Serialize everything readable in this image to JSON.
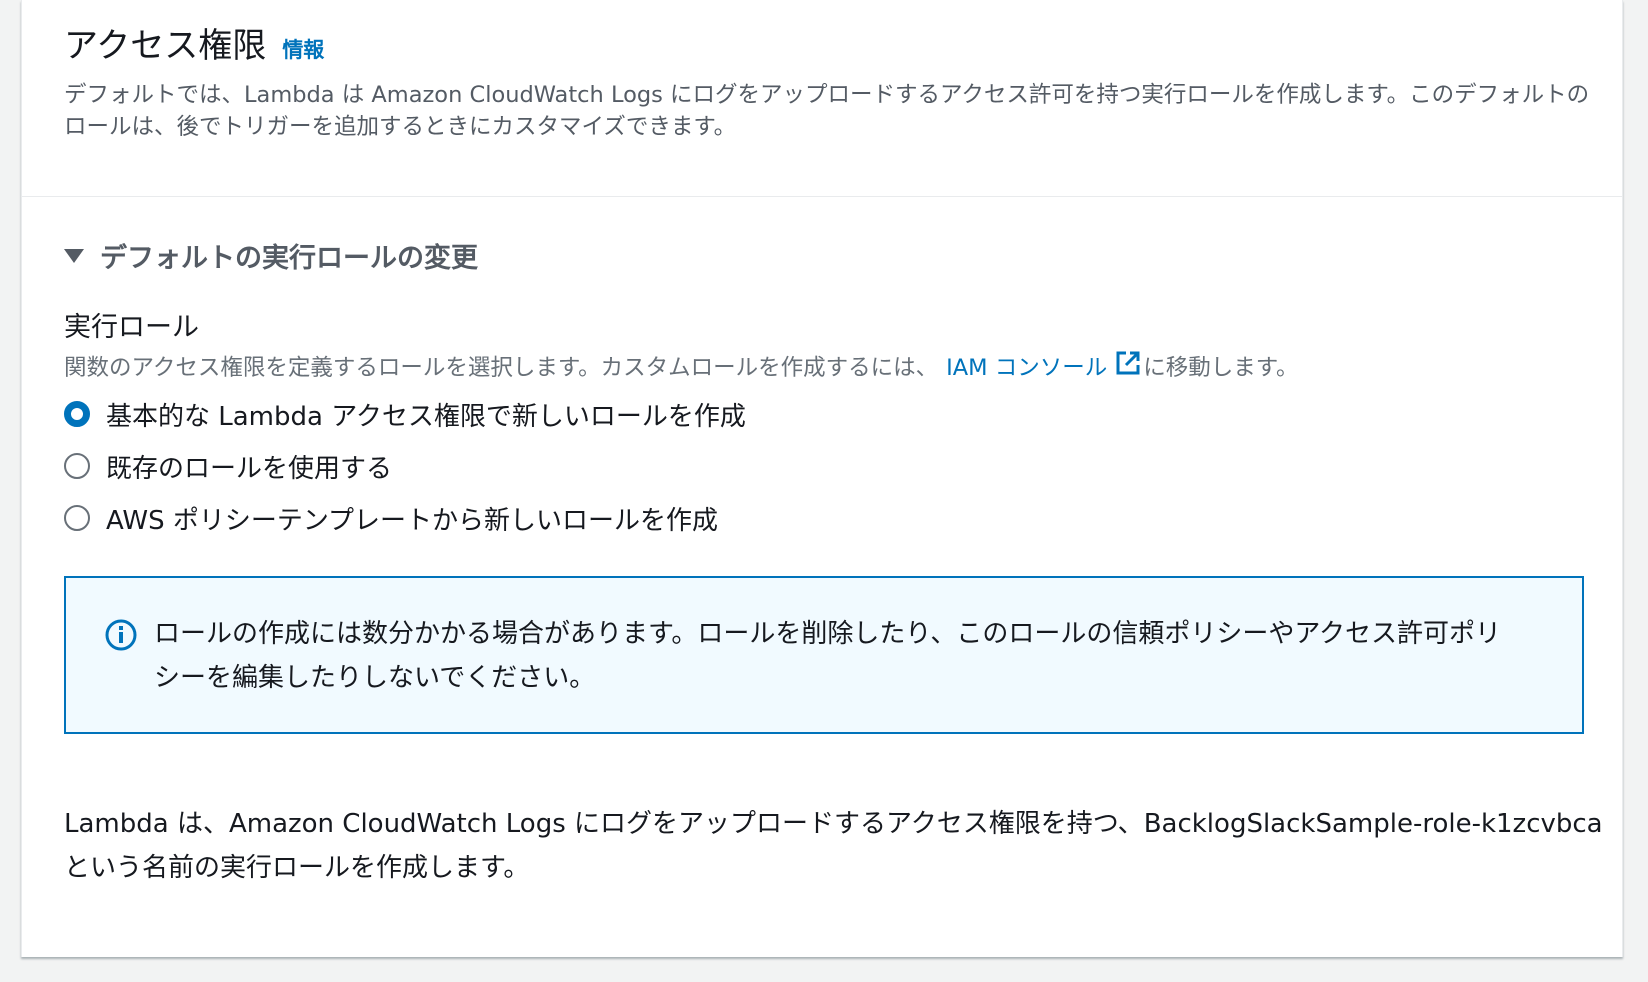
{
  "section": {
    "title": "アクセス権限",
    "info_link": "情報",
    "description": "デフォルトでは、Lambda は Amazon CloudWatch Logs にログをアップロードするアクセス許可を持つ実行ロールを作成します。このデフォルトのロールは、後でトリガーを追加するときにカスタマイズできます。"
  },
  "expander": {
    "label": "デフォルトの実行ロールの変更",
    "expanded": true
  },
  "execution_role": {
    "label": "実行ロール",
    "description_prefix": "関数のアクセス権限を定義するロールを選択します。カスタムロールを作成するには、",
    "iam_link": "IAM コンソール",
    "description_suffix": "に移動します。",
    "options": [
      {
        "label": "基本的な Lambda アクセス権限で新しいロールを作成",
        "checked": true
      },
      {
        "label": "既存のロールを使用する",
        "checked": false
      },
      {
        "label": "AWS ポリシーテンプレートから新しいロールを作成",
        "checked": false
      }
    ]
  },
  "alert": {
    "icon": "info-icon",
    "text": "ロールの作成には数分かかる場合があります。ロールを削除したり、このロールの信頼ポリシーやアクセス許可ポリシーを編集したりしないでください。"
  },
  "summary": {
    "prefix": "Lambda は、Amazon CloudWatch Logs にログをアップロードするアクセス権限を持つ、",
    "role_name": "BacklogSlackSample-role-k1zcvbca",
    "suffix": " という名前の実行ロールを作成します。"
  },
  "colors": {
    "link": "#0073bb",
    "alert_bg": "#f1faff",
    "text": "#16191f",
    "muted": "#545b64"
  }
}
